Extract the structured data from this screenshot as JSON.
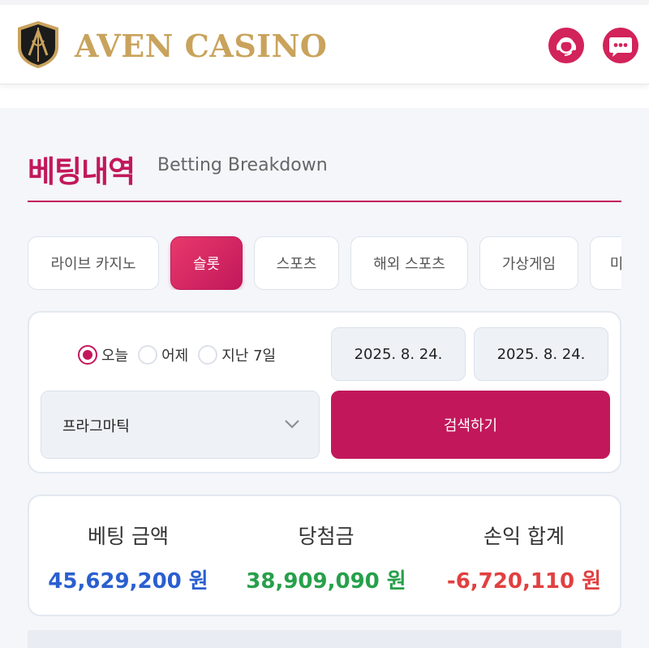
{
  "header": {
    "brand": "AVEN CASINO",
    "logo_icon": "aven-shield-logo",
    "support_icon": "support-agent-icon",
    "chat_icon": "chat-bubble-icon",
    "accent_color": "#d2235a",
    "brand_color": "#c9a35c"
  },
  "page": {
    "title_ko": "베팅내역",
    "title_en": "Betting Breakdown",
    "accent_color": "#c2185b"
  },
  "tabs": [
    {
      "label": "라이브 카지노",
      "active": false
    },
    {
      "label": "슬롯",
      "active": true
    },
    {
      "label": "스포츠",
      "active": false
    },
    {
      "label": "해외 스포츠",
      "active": false
    },
    {
      "label": "가상게임",
      "active": false
    },
    {
      "label": "미",
      "active": false
    }
  ],
  "search": {
    "range_options": [
      {
        "label": "오늘",
        "selected": true
      },
      {
        "label": "어제",
        "selected": false
      },
      {
        "label": "지난 7일",
        "selected": false
      }
    ],
    "date_from": "2025. 8. 24.",
    "date_to": "2025. 8. 24.",
    "provider_selected": "프라그마틱",
    "search_button": "검색하기"
  },
  "summary": {
    "bet_label": "베팅 금액",
    "bet_amount": "45,629,200 원",
    "win_label": "당첨금",
    "win_amount": "38,909,090 원",
    "net_label": "손익 합계",
    "net_amount": "-6,720,110 원",
    "colors": {
      "bet": "#2a5fd0",
      "win": "#27a04a",
      "net": "#e14040"
    }
  }
}
